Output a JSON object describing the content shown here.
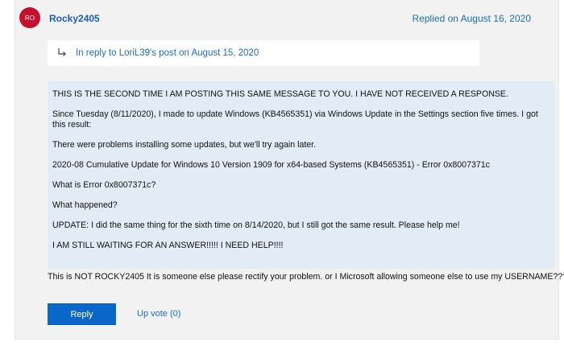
{
  "post": {
    "avatar_initials": "RO",
    "username": "Rocky2405",
    "replied_date": "Replied on August 16, 2020"
  },
  "reply_ref": {
    "text": "In reply to LoriL39's post on August 15, 2020"
  },
  "quote": {
    "paragraphs": [
      "THIS IS THE SECOND TIME I AM POSTING THIS SAME MESSAGE TO YOU.  I HAVE NOT RECEIVED A RESPONSE.",
      "Since Tuesday (8/11/2020), I made to update Windows (KB4565351) via Windows Update in the Settings section five times.  I got this result:",
      "There were problems installing some updates, but we'll try again later.",
      "2020-08 Cumulative Update for Windows 10 Version 1909 for x64-based Systems (KB4565351) - Error 0x8007371c",
      "What is Error 0x8007371c?",
      "What happened?",
      "UPDATE:  I did the same thing for the sixth time on 8/14/2020, but I still got the same result.  Please help me!",
      "I AM STILL WAITING FOR AN ANSWER!!!!!  I NEED HELP!!!!"
    ]
  },
  "body_text": "This is NOT ROCKY2405 It is someone else please rectify your problem. or I Microsoft allowing someone else to use my USERNAME???",
  "actions": {
    "reply_label": "Reply",
    "upvote_label": "Up vote (0)"
  }
}
